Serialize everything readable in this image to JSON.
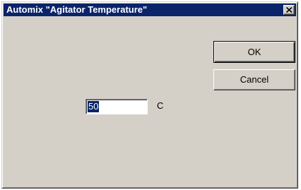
{
  "window": {
    "title": "Automix \"Agitator Temperature\"",
    "close_icon": "close-icon"
  },
  "buttons": {
    "ok_label": "OK",
    "cancel_label": "Cancel"
  },
  "field": {
    "value": "50",
    "unit": "C"
  },
  "colors": {
    "titlebar": "#0a246a",
    "face": "#d4d0c8",
    "selection": "#0a246a"
  }
}
